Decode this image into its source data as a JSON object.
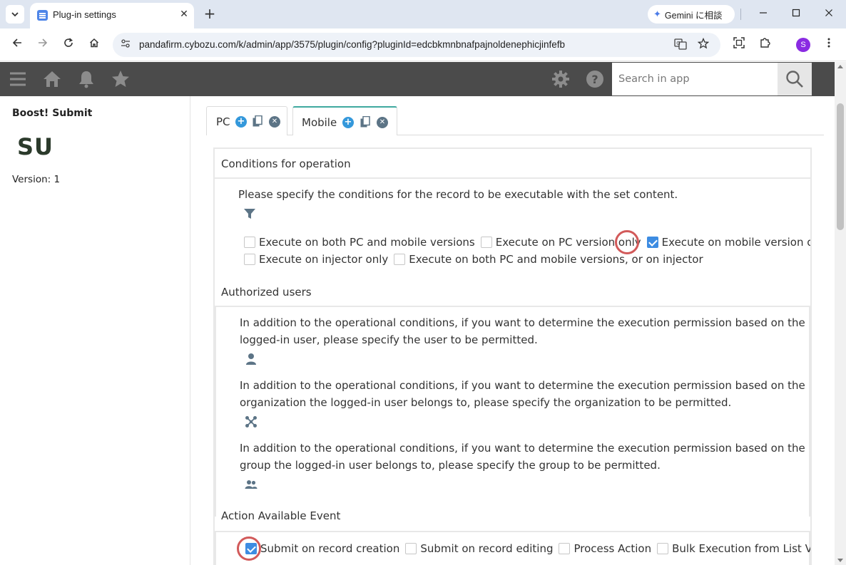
{
  "browser": {
    "tab_title": "Plug-in settings",
    "tab_close": "✕",
    "new_tab": "+",
    "gemini_label": "Gemini に相談",
    "url": "pandafirm.cybozu.com/k/admin/app/3575/plugin/config?pluginId=edcbkmnbnafpajnoldenephicjinfefb",
    "profile_initial": "S"
  },
  "header": {
    "search_placeholder": "Search in app"
  },
  "plugin": {
    "name": "Boost! Submit",
    "logo_text": "SU",
    "version": "Version: 1"
  },
  "tabs": [
    {
      "label": "PC",
      "active": false
    },
    {
      "label": "Mobile",
      "active": true
    }
  ],
  "conditions": {
    "heading": "Conditions for operation",
    "description": "Please specify the conditions for the record to be executable with the set content.",
    "options": [
      {
        "label": "Execute on both PC and mobile versions",
        "checked": false
      },
      {
        "label": "Execute on PC version only",
        "checked": false
      },
      {
        "label": "Execute on mobile version only",
        "checked": true
      },
      {
        "label": "Execute on injector only",
        "checked": false
      },
      {
        "label": "Execute on both PC and mobile versions, or on injector",
        "checked": false
      }
    ]
  },
  "authorized": {
    "heading": "Authorized users",
    "user_text": "In addition to the operational conditions, if you want to determine the execution permission based on the logged-in user, please specify the user to be permitted.",
    "org_text": "In addition to the operational conditions, if you want to determine the execution permission based on the organization the logged-in user belongs to, please specify the organization to be permitted.",
    "group_text": "In addition to the operational conditions, if you want to determine the execution permission based on the group the logged-in user belongs to, please specify the group to be permitted."
  },
  "events": {
    "heading": "Action Available Event",
    "options": [
      {
        "label": "Submit on record creation",
        "checked": true
      },
      {
        "label": "Submit on record editing",
        "checked": false
      },
      {
        "label": "Process Action",
        "checked": false
      },
      {
        "label": "Bulk Execution from List View",
        "checked": false
      }
    ]
  },
  "colors": {
    "app_header": "#4b4b4b",
    "accent_check": "#3d8ce2",
    "highlight_ring": "#d25a5a",
    "active_tab_border": "#3fa99f"
  },
  "icons": {
    "menu": "hamburger-icon",
    "home": "home-icon",
    "notifications": "bell-icon",
    "favorites": "star-icon",
    "settings": "gear-icon",
    "help": "help-icon",
    "search": "search-icon",
    "condition": "filter-icon",
    "user": "user-icon",
    "organization": "organization-icon",
    "group": "group-icon"
  }
}
